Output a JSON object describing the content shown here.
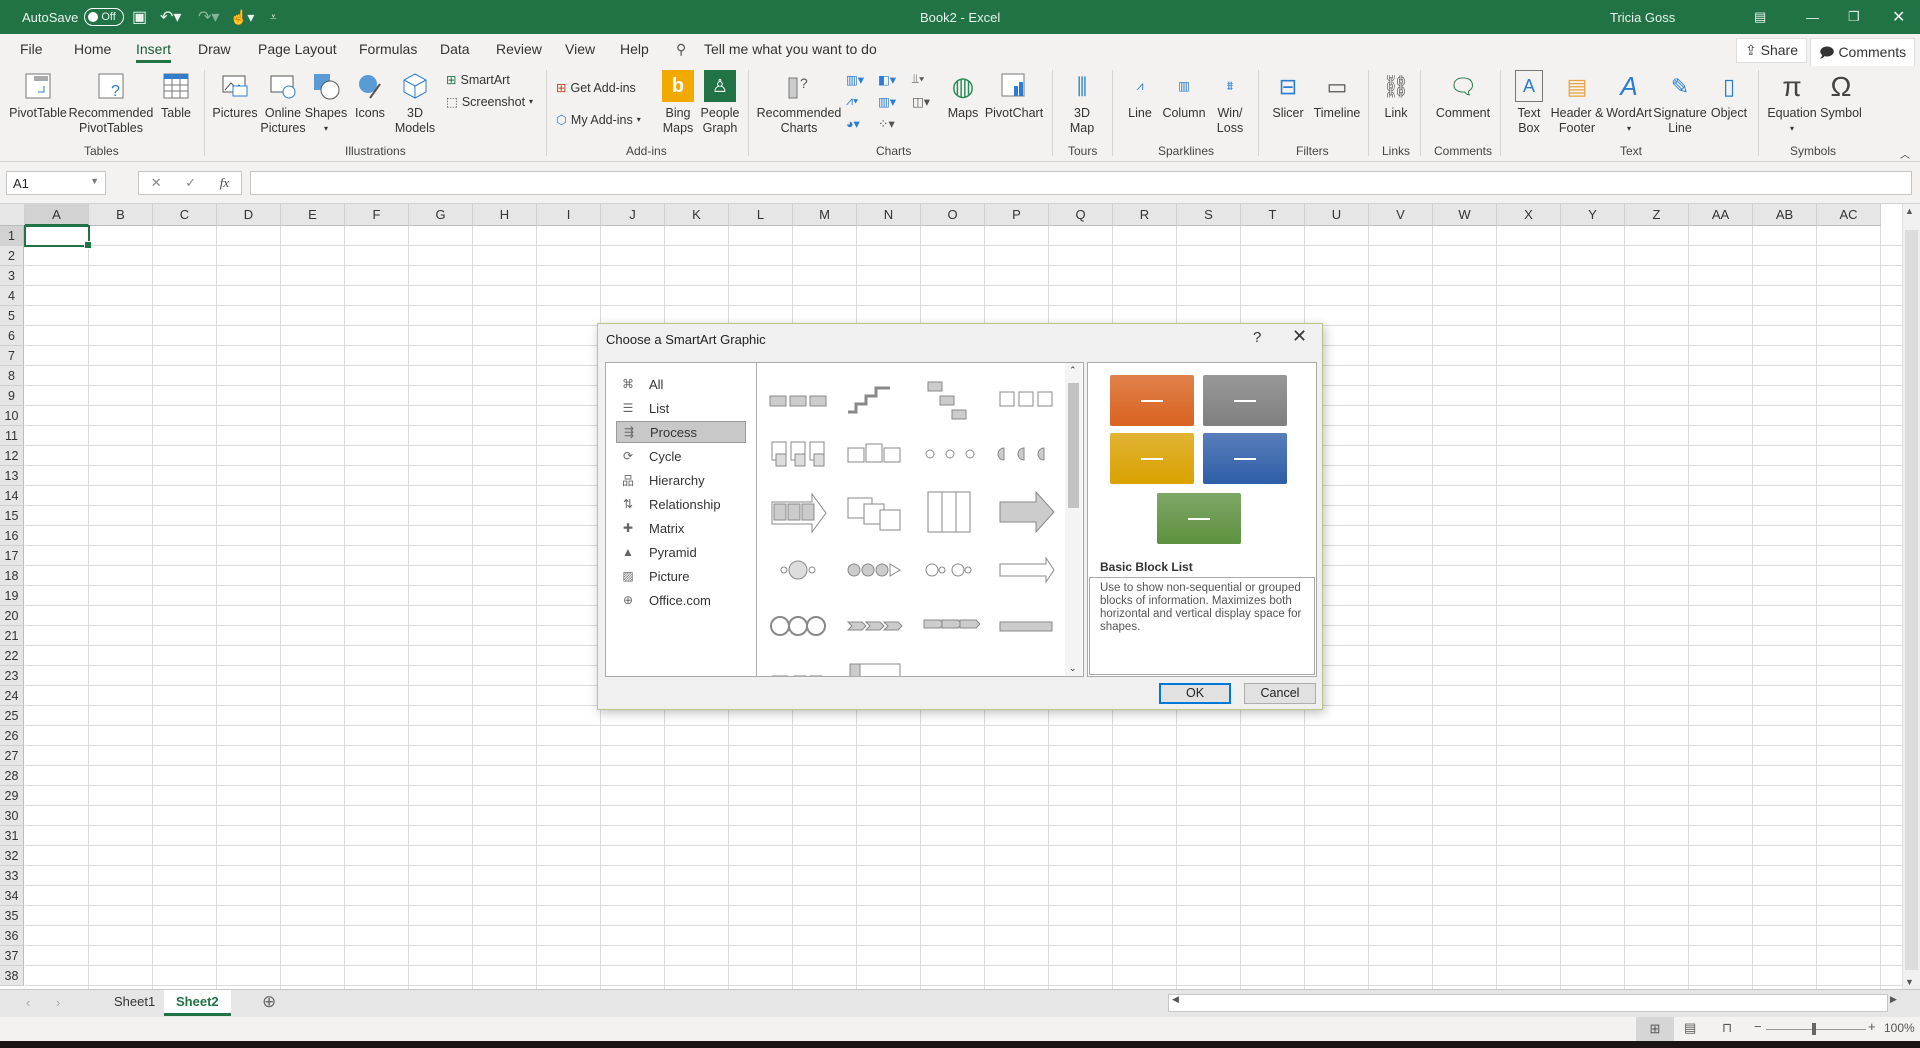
{
  "titlebar": {
    "autosave_label": "AutoSave",
    "autosave_state": "Off",
    "doc_title": "Book2  -  Excel",
    "user_name": "Tricia Goss"
  },
  "tabs": [
    "File",
    "Home",
    "Insert",
    "Draw",
    "Page Layout",
    "Formulas",
    "Data",
    "Review",
    "View",
    "Help"
  ],
  "active_tab": "Insert",
  "tell_me": "Tell me what you want to do",
  "share_label": "Share",
  "comments_label": "Comments",
  "ribbon": {
    "groups": {
      "tables": "Tables",
      "illustrations": "Illustrations",
      "addins": "Add-ins",
      "charts": "Charts",
      "tours": "Tours",
      "sparklines": "Sparklines",
      "filters": "Filters",
      "links": "Links",
      "comments": "Comments",
      "text": "Text",
      "symbols": "Symbols"
    },
    "buttons": {
      "pivottable": "PivotTable",
      "recommended_pivottables": "Recommended PivotTables",
      "table": "Table",
      "pictures": "Pictures",
      "online_pictures": "Online Pictures",
      "shapes": "Shapes",
      "icons": "Icons",
      "models3d": "3D Models",
      "smartart": "SmartArt",
      "screenshot": "Screenshot",
      "get_addins": "Get Add-ins",
      "my_addins": "My Add-ins",
      "bing_maps": "Bing Maps",
      "people_graph": "People Graph",
      "recommended_charts": "Recommended Charts",
      "maps": "Maps",
      "pivotchart": "PivotChart",
      "map3d": "3D Map",
      "line": "Line",
      "column": "Column",
      "winloss": "Win/ Loss",
      "slicer": "Slicer",
      "timeline": "Timeline",
      "link": "Link",
      "comment": "Comment",
      "textbox": "Text Box",
      "header_footer": "Header & Footer",
      "wordart": "WordArt",
      "signature_line": "Signature Line",
      "object": "Object",
      "equation": "Equation",
      "symbol": "Symbol"
    }
  },
  "formula_bar": {
    "name_box": "A1",
    "fx": "fx",
    "formula": ""
  },
  "columns": [
    "A",
    "B",
    "C",
    "D",
    "E",
    "F",
    "G",
    "H",
    "I",
    "J",
    "K",
    "L",
    "M",
    "N",
    "O",
    "P",
    "Q",
    "R",
    "S",
    "T",
    "U",
    "V",
    "W",
    "X",
    "Y",
    "Z",
    "AA",
    "AB",
    "AC"
  ],
  "rows": [
    "1",
    "2",
    "3",
    "4",
    "5",
    "6",
    "7",
    "8",
    "9",
    "10",
    "11",
    "12",
    "13",
    "14",
    "15",
    "16",
    "17",
    "18",
    "19",
    "20",
    "21",
    "22",
    "23",
    "24",
    "25",
    "26",
    "27",
    "28",
    "29",
    "30",
    "31",
    "32",
    "33",
    "34",
    "35",
    "36",
    "37",
    "38"
  ],
  "sheets": [
    "Sheet1",
    "Sheet2"
  ],
  "active_sheet": "Sheet2",
  "status": {
    "zoom": "100%"
  },
  "dialog": {
    "title": "Choose a SmartArt Graphic",
    "help": "?",
    "close": "✕",
    "categories": [
      {
        "label": "All",
        "icon": "all-icon"
      },
      {
        "label": "List",
        "icon": "list-icon"
      },
      {
        "label": "Process",
        "icon": "process-icon"
      },
      {
        "label": "Cycle",
        "icon": "cycle-icon"
      },
      {
        "label": "Hierarchy",
        "icon": "hierarchy-icon"
      },
      {
        "label": "Relationship",
        "icon": "relationship-icon"
      },
      {
        "label": "Matrix",
        "icon": "matrix-icon"
      },
      {
        "label": "Pyramid",
        "icon": "pyramid-icon"
      },
      {
        "label": "Picture",
        "icon": "picture-icon"
      },
      {
        "label": "Office.com",
        "icon": "globe-icon"
      }
    ],
    "selected_category": "Process",
    "preview": {
      "name": "Basic Block List",
      "description": "Use to show non-sequential or grouped blocks of information. Maximizes both horizontal and vertical display space for shapes.",
      "colors": [
        "#d9621f",
        "#7f7f7f",
        "#d9a100",
        "#2e5ea8",
        "#5d9140"
      ]
    },
    "ok_label": "OK",
    "cancel_label": "Cancel"
  }
}
